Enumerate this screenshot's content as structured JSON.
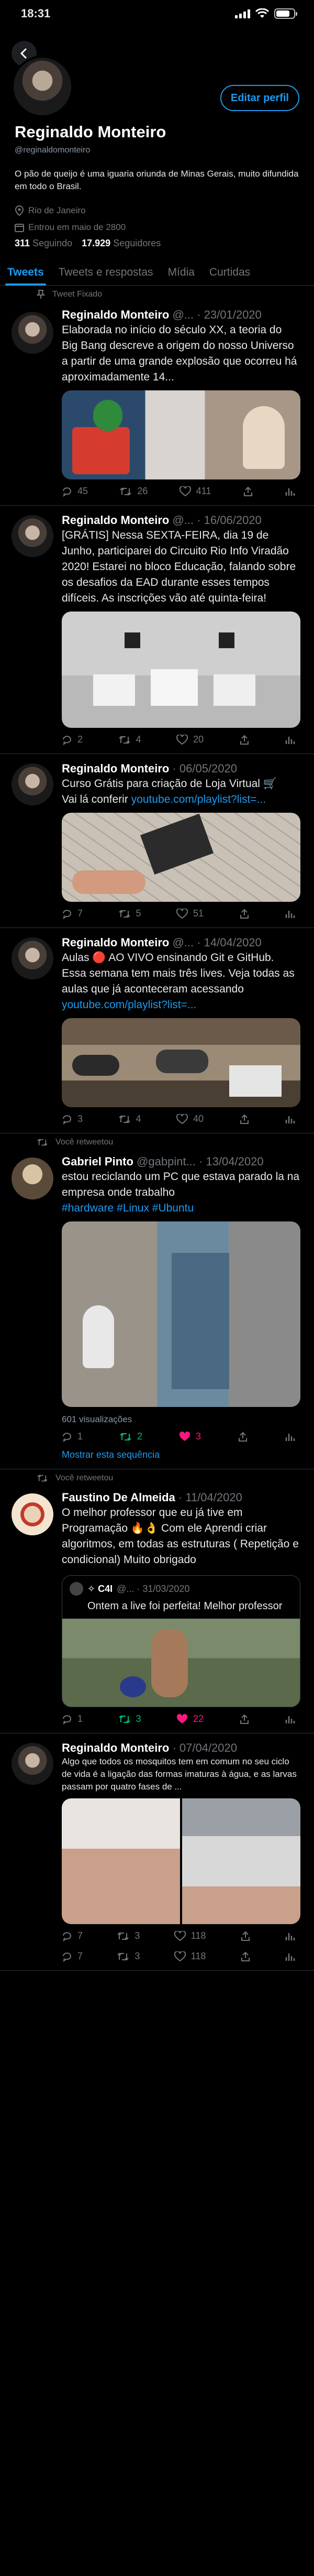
{
  "status_bar": {
    "time": "18:31"
  },
  "profile": {
    "name": "Reginaldo Monteiro",
    "handle": "@reginaldomonteiro",
    "edit_label": "Editar perfil",
    "bio": "O pão de queijo é uma iguaria oriunda de Minas Gerais, muito difundida em todo o Brasil.",
    "location": "Rio de Janeiro",
    "joined": "Entrou em maio de 2800",
    "following_count": "311",
    "following_label": "Seguindo",
    "followers_count": "17.929",
    "followers_label": "Seguidores"
  },
  "tabs": [
    "Tweets",
    "Tweets e respostas",
    "Mídia",
    "Curtidas"
  ],
  "tweets": [
    {
      "context": "Tweet Fixado",
      "name": "Reginaldo Monteiro",
      "meta": "@... · 23/01/2020",
      "text": "Elaborada no início do século XX, a teoria do Big Bang descreve a origem do nosso Universo a partir de uma grande explosão que ocorreu há aproximadamente 14...",
      "replies": "45",
      "retweets": "26",
      "likes": "411"
    },
    {
      "name": "Reginaldo Monteiro",
      "meta": "@... · 16/06/2020",
      "text": "[GRÁTIS] Nessa SEXTA-FEIRA, dia 19 de Junho, participarei do Circuito Rio Info Viradão 2020! Estarei no bloco Educação, falando sobre os desafios da EAD durante esses tempos difíceis. As inscrições vão até quinta-feira! Espero...",
      "replies": "2",
      "retweets": "4",
      "likes": "20"
    },
    {
      "name": "Reginaldo Monteiro",
      "meta": "· 06/05/2020",
      "text": "Curso Grátis para criação de Loja Virtual 🛒",
      "text2": "Vai lá conferir",
      "link": "youtube.com/playlist?list=...",
      "replies": "7",
      "retweets": "5",
      "likes": "51"
    },
    {
      "name": "Reginaldo Monteiro",
      "meta": "@... · 14/04/2020",
      "text": "Aulas 🔴 AO VIVO ensinando Git e GitHub. Essa semana tem mais três lives. Veja todas as aulas que já aconteceram acessando",
      "link": "youtube.com/playlist?list=...",
      "replies": "3",
      "retweets": "4",
      "likes": "40"
    },
    {
      "context": "Você retweetou",
      "name": "Gabriel Pinto",
      "meta": "@gabpint... · 13/04/2020",
      "text": "estou reciclando um PC que estava parado la na empresa onde trabalho",
      "hashtags": "#hardware #Linux #Ubuntu",
      "views": "601 visualizações",
      "replies": "1",
      "retweets": "2",
      "likes": "3",
      "thread": "Mostrar esta sequência"
    },
    {
      "context": "Você retweetou",
      "name": "Faustino De Almeida",
      "meta": "· 11/04/2020",
      "text": "O melhor professor que eu já tive em Programação 🔥👌 Com ele Aprendi criar algoritmos, em todas as estruturas ( Repetição e condicional) Muito obrigado",
      "quote_name": "✧ C4I",
      "quote_meta": "@... · 31/03/2020",
      "quote_text": "Ontem a live foi perfeita! Melhor professor",
      "replies": "1",
      "retweets": "3",
      "likes": "22"
    },
    {
      "name": "Reginaldo Monteiro",
      "meta": "· 07/04/2020",
      "text": "Algo que todos os mosquitos tem em comum no seu ciclo de vida é a ligação das formas imaturas à água, e as larvas passam por quatro fases de ...",
      "replies": "7",
      "retweets": "3",
      "likes": "118",
      "replies2": "7",
      "retweets2": "3",
      "likes2": "118"
    }
  ]
}
